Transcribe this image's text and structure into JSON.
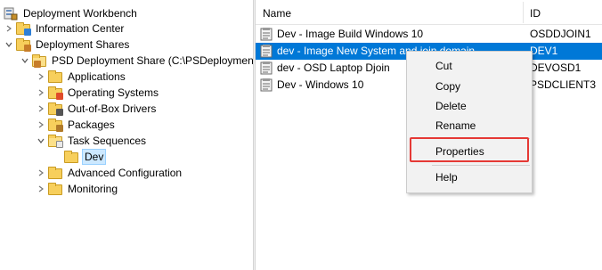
{
  "tree": {
    "items": [
      {
        "label": "Deployment Workbench"
      },
      {
        "label": "Information Center"
      },
      {
        "label": "Deployment Shares"
      },
      {
        "label": "PSD Deployment Share (C:\\PSDeployment)"
      },
      {
        "label": "Applications"
      },
      {
        "label": "Operating Systems"
      },
      {
        "label": "Out-of-Box Drivers"
      },
      {
        "label": "Packages"
      },
      {
        "label": "Task Sequences"
      },
      {
        "label": "Dev"
      },
      {
        "label": "Advanced Configuration"
      },
      {
        "label": "Monitoring"
      }
    ]
  },
  "list": {
    "columns": {
      "name": "Name",
      "id": "ID"
    },
    "rows": [
      {
        "name": "Dev - Image Build Windows 10",
        "id": "OSDDJOIN1"
      },
      {
        "name": "dev - Image New System and join domain",
        "id": "DEV1"
      },
      {
        "name": "dev - OSD Laptop Djoin",
        "id": "DEVOSD1"
      },
      {
        "name": "Dev - Windows 10",
        "id": "PSDCLIENT3"
      }
    ]
  },
  "context_menu": {
    "items": [
      "Cut",
      "Copy",
      "Delete",
      "Rename",
      "Properties",
      "Help"
    ]
  },
  "colors": {
    "selection": "#0078d7",
    "highlight": "#e53935",
    "folder": "#f7cf5c"
  }
}
